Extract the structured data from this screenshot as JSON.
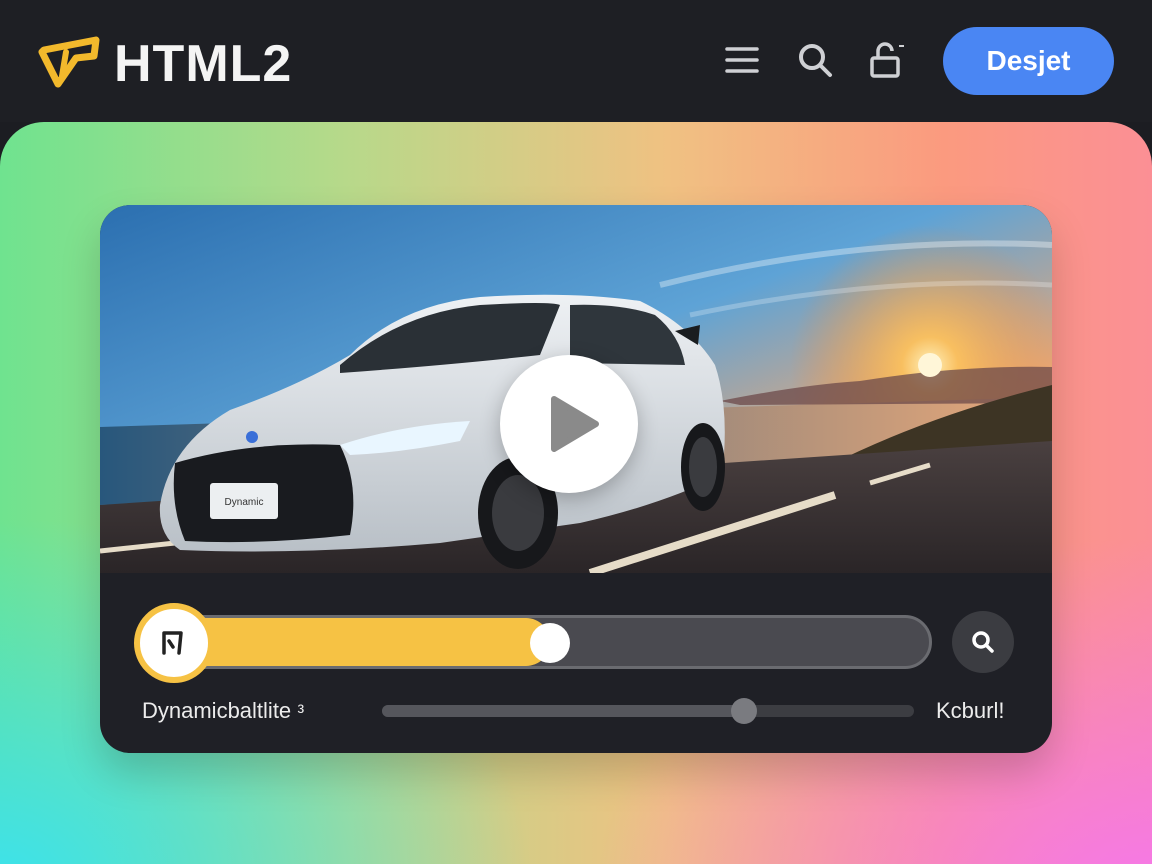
{
  "header": {
    "brand": "HTML2",
    "cta_label": "Desjet",
    "icons": [
      "menu-icon",
      "search-icon",
      "lock-icon"
    ]
  },
  "player": {
    "thumbnail_subject": "white sports car on coastal road at sunset",
    "plate_text": "Dynamic",
    "play_icon": "play-icon",
    "progress_fraction": 0.52,
    "cap_icon": "bookmark-icon",
    "search_icon": "search-icon"
  },
  "controls": {
    "left_label": "Dynamicbaltlite ᵌ",
    "right_label": "Kcburl!",
    "secondary_fraction": 0.68
  },
  "colors": {
    "accent": "#f6c244",
    "cta": "#4a86f3",
    "card": "#1f2026"
  }
}
